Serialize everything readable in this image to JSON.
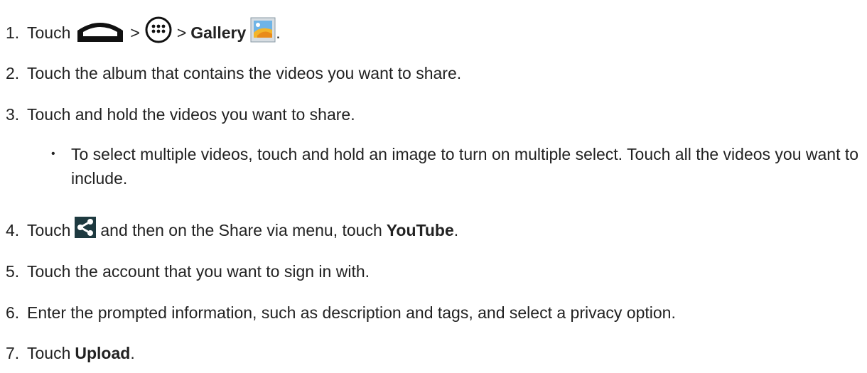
{
  "steps": [
    {
      "num": "1.",
      "pre": "Touch",
      "sep1": ">",
      "sep2": ">",
      "bold": "Gallery",
      "post": "."
    },
    {
      "num": "2.",
      "text": "Touch the album that contains the videos you want to share."
    },
    {
      "num": "3.",
      "text": "Touch and hold the videos you want to share."
    },
    {
      "num": "4.",
      "pre": "Touch",
      "mid": "and then on the Share via menu, touch",
      "bold": "YouTube",
      "post": "."
    },
    {
      "num": "5.",
      "text": "Touch the account that you want to sign in with."
    },
    {
      "num": "6.",
      "text": "Enter the prompted information, such as description and tags, and select a privacy option."
    },
    {
      "num": "7.",
      "pre": "Touch",
      "bold": "Upload",
      "post": "."
    }
  ],
  "substep": {
    "text": "To select multiple videos, touch and hold an image to turn on multiple select. Touch all the videos you want to include."
  },
  "icons": {
    "home": "home-icon",
    "apps": "apps-icon",
    "gallery": "gallery-icon",
    "share": "share-icon"
  },
  "colors": {
    "text": "#222222",
    "share_bg": "#1e3a40",
    "share_fg": "#ffffff"
  }
}
